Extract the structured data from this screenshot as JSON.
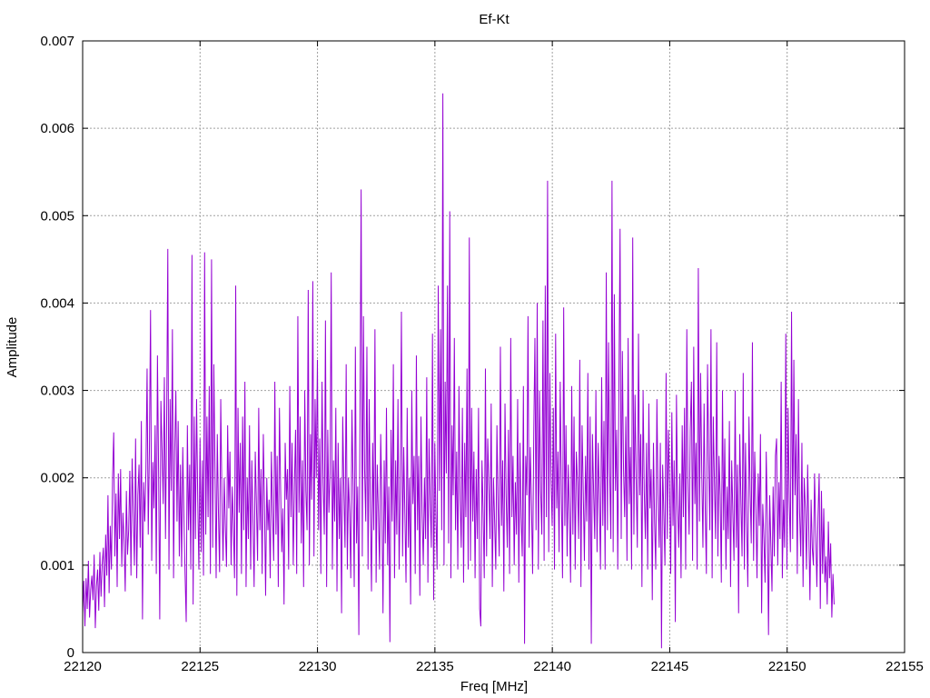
{
  "chart_data": {
    "type": "line",
    "title": "Ef-Kt",
    "xlabel": "Freq [MHz]",
    "ylabel": "Amplitude",
    "xlim": [
      22120,
      22155
    ],
    "ylim": [
      0,
      0.007
    ],
    "xticks": [
      "22120",
      "22125",
      "22130",
      "22135",
      "22140",
      "22145",
      "22150",
      "22155"
    ],
    "yticks": [
      "0",
      "0.001",
      "0.002",
      "0.003",
      "0.004",
      "0.005",
      "0.006",
      "0.007"
    ],
    "grid": true,
    "series_color": "#9400d3",
    "series": [
      {
        "x_start": 22120,
        "x_end": 22152,
        "values": [
          0.00045,
          0.00082,
          0.0003,
          0.00085,
          0.0005,
          0.00105,
          0.0004,
          0.00072,
          0.00088,
          0.0006,
          0.00112,
          0.00028,
          0.00076,
          0.00095,
          0.00048,
          0.00115,
          0.00064,
          0.00102,
          0.0012,
          0.00052,
          0.00135,
          0.00088,
          0.0018,
          0.00068,
          0.00145,
          0.00095,
          0.002,
          0.00252,
          0.0011,
          0.00182,
          0.00075,
          0.00205,
          0.0013,
          0.0021,
          0.00098,
          0.0016,
          0.00128,
          0.0007,
          0.00185,
          0.00112,
          0.0014,
          0.00208,
          0.00088,
          0.00222,
          0.0016,
          0.001,
          0.00245,
          0.00085,
          0.0018,
          0.00215,
          0.0012,
          0.00265,
          0.00038,
          0.00195,
          0.0015,
          0.0021,
          0.00325,
          0.00135,
          0.0023,
          0.00392,
          0.00105,
          0.00218,
          0.00165,
          0.0026,
          0.0009,
          0.0034,
          0.00208,
          0.00038,
          0.00288,
          0.00232,
          0.0017,
          0.00315,
          0.0013,
          0.00265,
          0.00462,
          0.00095,
          0.0029,
          0.00185,
          0.0037,
          0.00085,
          0.0023,
          0.003,
          0.0015,
          0.00265,
          0.0011,
          0.00215,
          0.00098,
          0.00235,
          0.00155,
          0.0009,
          0.00035,
          0.0026,
          0.0014,
          0.00215,
          0.00095,
          0.00455,
          0.00055,
          0.0027,
          0.0013,
          0.0029,
          0.00175,
          0.00095,
          0.00245,
          0.00115,
          0.0022,
          0.00088,
          0.00458,
          0.00135,
          0.0027,
          0.00155,
          0.00305,
          0.0009,
          0.0045,
          0.0012,
          0.0033,
          0.0021,
          0.00085,
          0.0025,
          0.0016,
          0.00092,
          0.0029,
          0.0018,
          0.00105,
          0.002,
          0.00145,
          0.00098,
          0.0026,
          0.00165,
          0.0023,
          0.001,
          0.0019,
          0.00145,
          0.00085,
          0.0042,
          0.00065,
          0.0028,
          0.0016,
          0.0024,
          0.0009,
          0.0027,
          0.0014,
          0.0031,
          0.00075,
          0.002,
          0.0013,
          0.0026,
          0.00095,
          0.0022,
          0.0015,
          0.00075,
          0.0023,
          0.0017,
          0.00105,
          0.0028,
          0.0014,
          0.0021,
          0.0009,
          0.0025,
          0.0017,
          0.00065,
          0.002,
          0.0014,
          0.00175,
          0.00085,
          0.0023,
          0.0016,
          0.00105,
          0.0031,
          0.00135,
          0.00225,
          0.00075,
          0.0028,
          0.0019,
          0.00115,
          0.00165,
          0.00055,
          0.0024,
          0.00175,
          0.0021,
          0.00095,
          0.00305,
          0.00155,
          0.0024,
          0.001,
          0.0019,
          0.00255,
          0.0009,
          0.00385,
          0.0016,
          0.0027,
          0.00125,
          0.0022,
          0.00075,
          0.003,
          0.00185,
          0.0014,
          0.00415,
          0.001,
          0.0025,
          0.00175,
          0.00425,
          0.0011,
          0.0029,
          0.002,
          0.00335,
          0.0014,
          0.00245,
          0.0009,
          0.0031,
          0.00195,
          0.00135,
          0.0038,
          0.00075,
          0.00255,
          0.0016,
          0.00205,
          0.00435,
          0.00095,
          0.0022,
          0.0015,
          0.0028,
          0.0007,
          0.0024,
          0.0013,
          0.002,
          0.00045,
          0.0027,
          0.00185,
          0.0012,
          0.0033,
          0.00095,
          0.002,
          0.0016,
          0.00085,
          0.00278,
          0.00195,
          0.00075,
          0.0035,
          0.00125,
          0.0019,
          0.0002,
          0.0027,
          0.0053,
          0.0011,
          0.00385,
          0.0021,
          0.0015,
          0.0035,
          0.00095,
          0.0029,
          0.00165,
          0.0007,
          0.0024,
          0.0014,
          0.0037,
          0.0008,
          0.00215,
          0.0016,
          0.00095,
          0.0025,
          0.00175,
          0.00045,
          0.0022,
          0.00125,
          0.0028,
          0.001,
          0.0019,
          0.00012,
          0.00255,
          0.0015,
          0.0033,
          0.00085,
          0.0022,
          0.00135,
          0.0029,
          0.00095,
          0.00185,
          0.0039,
          0.0011,
          0.00235,
          0.0016,
          0.0008,
          0.0028,
          0.0012,
          0.002,
          0.00055,
          0.003,
          0.0017,
          0.00225,
          0.0009,
          0.0034,
          0.0014,
          0.00225,
          0.00065,
          0.0027,
          0.0016,
          0.001,
          0.002,
          0.0013,
          0.00315,
          0.0008,
          0.00245,
          0.00175,
          0.0012,
          0.00365,
          0.0006,
          0.0024,
          0.00155,
          0.00095,
          0.0042,
          0.00185,
          0.0037,
          0.0014,
          0.0064,
          0.001,
          0.0031,
          0.00205,
          0.0042,
          0.00125,
          0.00505,
          0.00085,
          0.0026,
          0.0018,
          0.0036,
          0.0014,
          0.0023,
          0.00095,
          0.00305,
          0.00175,
          0.0012,
          0.0028,
          0.0008,
          0.0024,
          0.00155,
          0.00325,
          0.00095,
          0.00475,
          0.00105,
          0.0028,
          0.0015,
          0.0023,
          0.00085,
          0.0021,
          0.0013,
          0.0028,
          0.0005,
          0.0003,
          0.0022,
          0.0016,
          0.00085,
          0.00325,
          0.0011,
          0.00245,
          0.0019,
          0.0013,
          0.00285,
          0.00075,
          0.002,
          0.0015,
          0.00095,
          0.0026,
          0.00165,
          0.0011,
          0.0035,
          0.00145,
          0.0022,
          0.0007,
          0.00285,
          0.0018,
          0.0012,
          0.00255,
          0.0009,
          0.0036,
          0.00155,
          0.00225,
          0.001,
          0.00195,
          0.00135,
          0.0029,
          0.0008,
          0.0024,
          0.00155,
          0.0011,
          0.00305,
          0.0001,
          0.00225,
          0.0018,
          0.00385,
          0.0012,
          0.00235,
          0.0017,
          0.0009,
          0.0025,
          0.0036,
          0.0014,
          0.004,
          0.00095,
          0.003,
          0.00185,
          0.00135,
          0.0038,
          0.00105,
          0.0042,
          0.00155,
          0.0054,
          0.00115,
          0.0032,
          0.002,
          0.00145,
          0.0028,
          0.00095,
          0.00365,
          0.00165,
          0.0023,
          0.00115,
          0.0031,
          0.0018,
          0.00085,
          0.00395,
          0.00145,
          0.0026,
          0.0011,
          0.00215,
          0.0016,
          0.0008,
          0.00305,
          0.00135,
          0.0027,
          0.00095,
          0.0023,
          0.00195,
          0.0013,
          0.00335,
          0.00075,
          0.0026,
          0.00185,
          0.00105,
          0.00225,
          0.0015,
          0.0032,
          0.00095,
          0.0027,
          0.0001,
          0.0025,
          0.00185,
          0.0013,
          0.003,
          0.00115,
          0.0024,
          0.00175,
          0.00095,
          0.00315,
          0.00145,
          0.00265,
          0.00095,
          0.00435,
          0.0014,
          0.00355,
          0.00205,
          0.0013,
          0.0054,
          0.00115,
          0.0041,
          0.00185,
          0.00255,
          0.00095,
          0.00305,
          0.00485,
          0.0013,
          0.00345,
          0.0021,
          0.00155,
          0.0027,
          0.00105,
          0.0036,
          0.0017,
          0.00235,
          0.00095,
          0.00475,
          0.00135,
          0.00295,
          0.00195,
          0.0012,
          0.00365,
          0.0018,
          0.0025,
          0.00075,
          0.003,
          0.00185,
          0.0013,
          0.0024,
          0.00095,
          0.00285,
          0.00165,
          0.0021,
          0.0006,
          0.0024,
          0.0015,
          0.00095,
          0.0029,
          0.0018,
          0.0012,
          0.0024,
          5e-05,
          0.00215,
          0.0016,
          0.001,
          0.0032,
          0.0013,
          0.00255,
          0.00195,
          0.0009,
          0.00275,
          0.00145,
          0.0022,
          0.00035,
          0.00295,
          0.0017,
          0.0012,
          0.00205,
          0.00085,
          0.0026,
          0.00155,
          0.0028,
          0.00095,
          0.0037,
          0.00195,
          0.00135,
          0.00255,
          0.0031,
          0.00105,
          0.0035,
          0.0017,
          0.0024,
          0.00095,
          0.0044,
          0.0015,
          0.0032,
          0.00205,
          0.0012,
          0.00285,
          0.00165,
          0.0009,
          0.0033,
          0.00225,
          0.0014,
          0.0037,
          0.00085,
          0.0027,
          0.00195,
          0.0013,
          0.00355,
          0.0011,
          0.00225,
          0.0018,
          0.0008,
          0.003,
          0.0014,
          0.00245,
          0.00095,
          0.0019,
          0.0013,
          0.00265,
          0.00075,
          0.0022,
          0.0016,
          0.00105,
          0.003,
          0.0012,
          0.00215,
          0.00045,
          0.0025,
          0.00175,
          0.0011,
          0.0032,
          0.00095,
          0.0024,
          0.0015,
          0.00075,
          0.0027,
          0.00185,
          0.00125,
          0.00355,
          0.00105,
          0.0023,
          0.00165,
          0.00085,
          0.00205,
          0.00145,
          0.0025,
          0.00045,
          0.0017,
          0.0013,
          0.0008,
          0.0023,
          0.0015,
          0.0002,
          0.0018,
          0.00125,
          0.0007,
          0.0019,
          0.0011,
          0.00225,
          0.00245,
          0.001,
          0.00195,
          0.0013,
          0.0031,
          0.00085,
          0.00175,
          0.0012,
          0.00365,
          0.00095,
          0.0028,
          0.00175,
          0.00115,
          0.0039,
          0.0013,
          0.00335,
          0.0018,
          0.0025,
          0.0009,
          0.0029,
          0.0016,
          0.0011,
          0.0024,
          0.00075,
          0.002,
          0.00165,
          0.00095,
          0.00215,
          0.0014,
          0.0006,
          0.00175,
          0.0012,
          0.001,
          0.00205,
          0.0014,
          0.00075,
          0.00155,
          0.00205,
          0.0005,
          0.00185,
          0.0009,
          0.00165,
          0.0008,
          0.0011,
          0.00055,
          0.0015,
          0.00085,
          0.00125,
          0.0004,
          0.0009,
          0.00055
        ]
      }
    ]
  }
}
